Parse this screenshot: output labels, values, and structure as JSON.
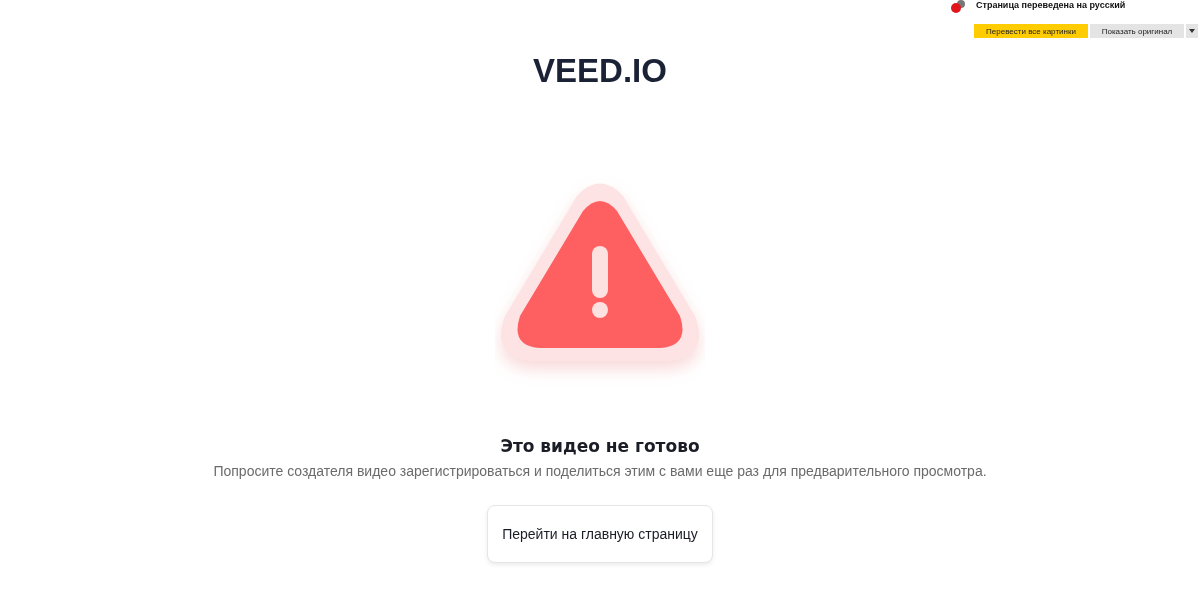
{
  "translate_bar": {
    "message": "Страница переведена на русский",
    "buttons": [
      {
        "label": "Перевести все картинки",
        "kind": "primary"
      },
      {
        "label": "Показать оригинал",
        "kind": "secondary"
      }
    ]
  },
  "logo": "VEED.IO",
  "error": {
    "title": "Это видео не готово",
    "message": "Попросите создателя видео зарегистрироваться и поделиться этим с вами еще раз для предварительного просмотра.",
    "button": "Перейти на главную страницу"
  }
}
